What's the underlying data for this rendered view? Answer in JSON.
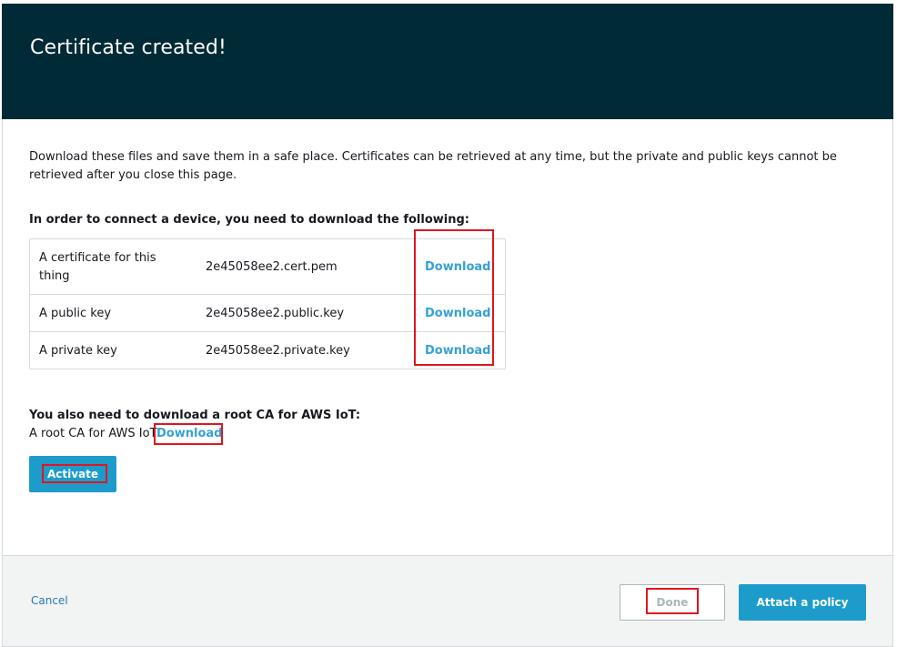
{
  "header": {
    "title": "Certificate created!"
  },
  "intro": {
    "text": "Download these files and save them in a safe place. Certificates can be retrieved at any time, but the private and public keys cannot be retrieved after you close this page."
  },
  "files_section": {
    "title": "In order to connect a device, you need to download the following:",
    "rows": [
      {
        "description": "A certificate for this thing",
        "filename": "2e45058ee2.cert.pem",
        "action": "Download"
      },
      {
        "description": "A public key",
        "filename": "2e45058ee2.public.key",
        "action": "Download"
      },
      {
        "description": "A private key",
        "filename": "2e45058ee2.private.key",
        "action": "Download"
      }
    ]
  },
  "root_ca": {
    "title": "You also need to download a root CA for AWS IoT:",
    "text": "A root CA for AWS IoT",
    "action": "Download"
  },
  "activate_label": "Activate",
  "footer": {
    "cancel_label": "Cancel",
    "done_label": "Done",
    "attach_label": "Attach a policy"
  },
  "colors": {
    "header_bg": "#002b36",
    "primary": "#1d9ccb",
    "link": "#36a1d4",
    "highlight": "#e0161e"
  }
}
